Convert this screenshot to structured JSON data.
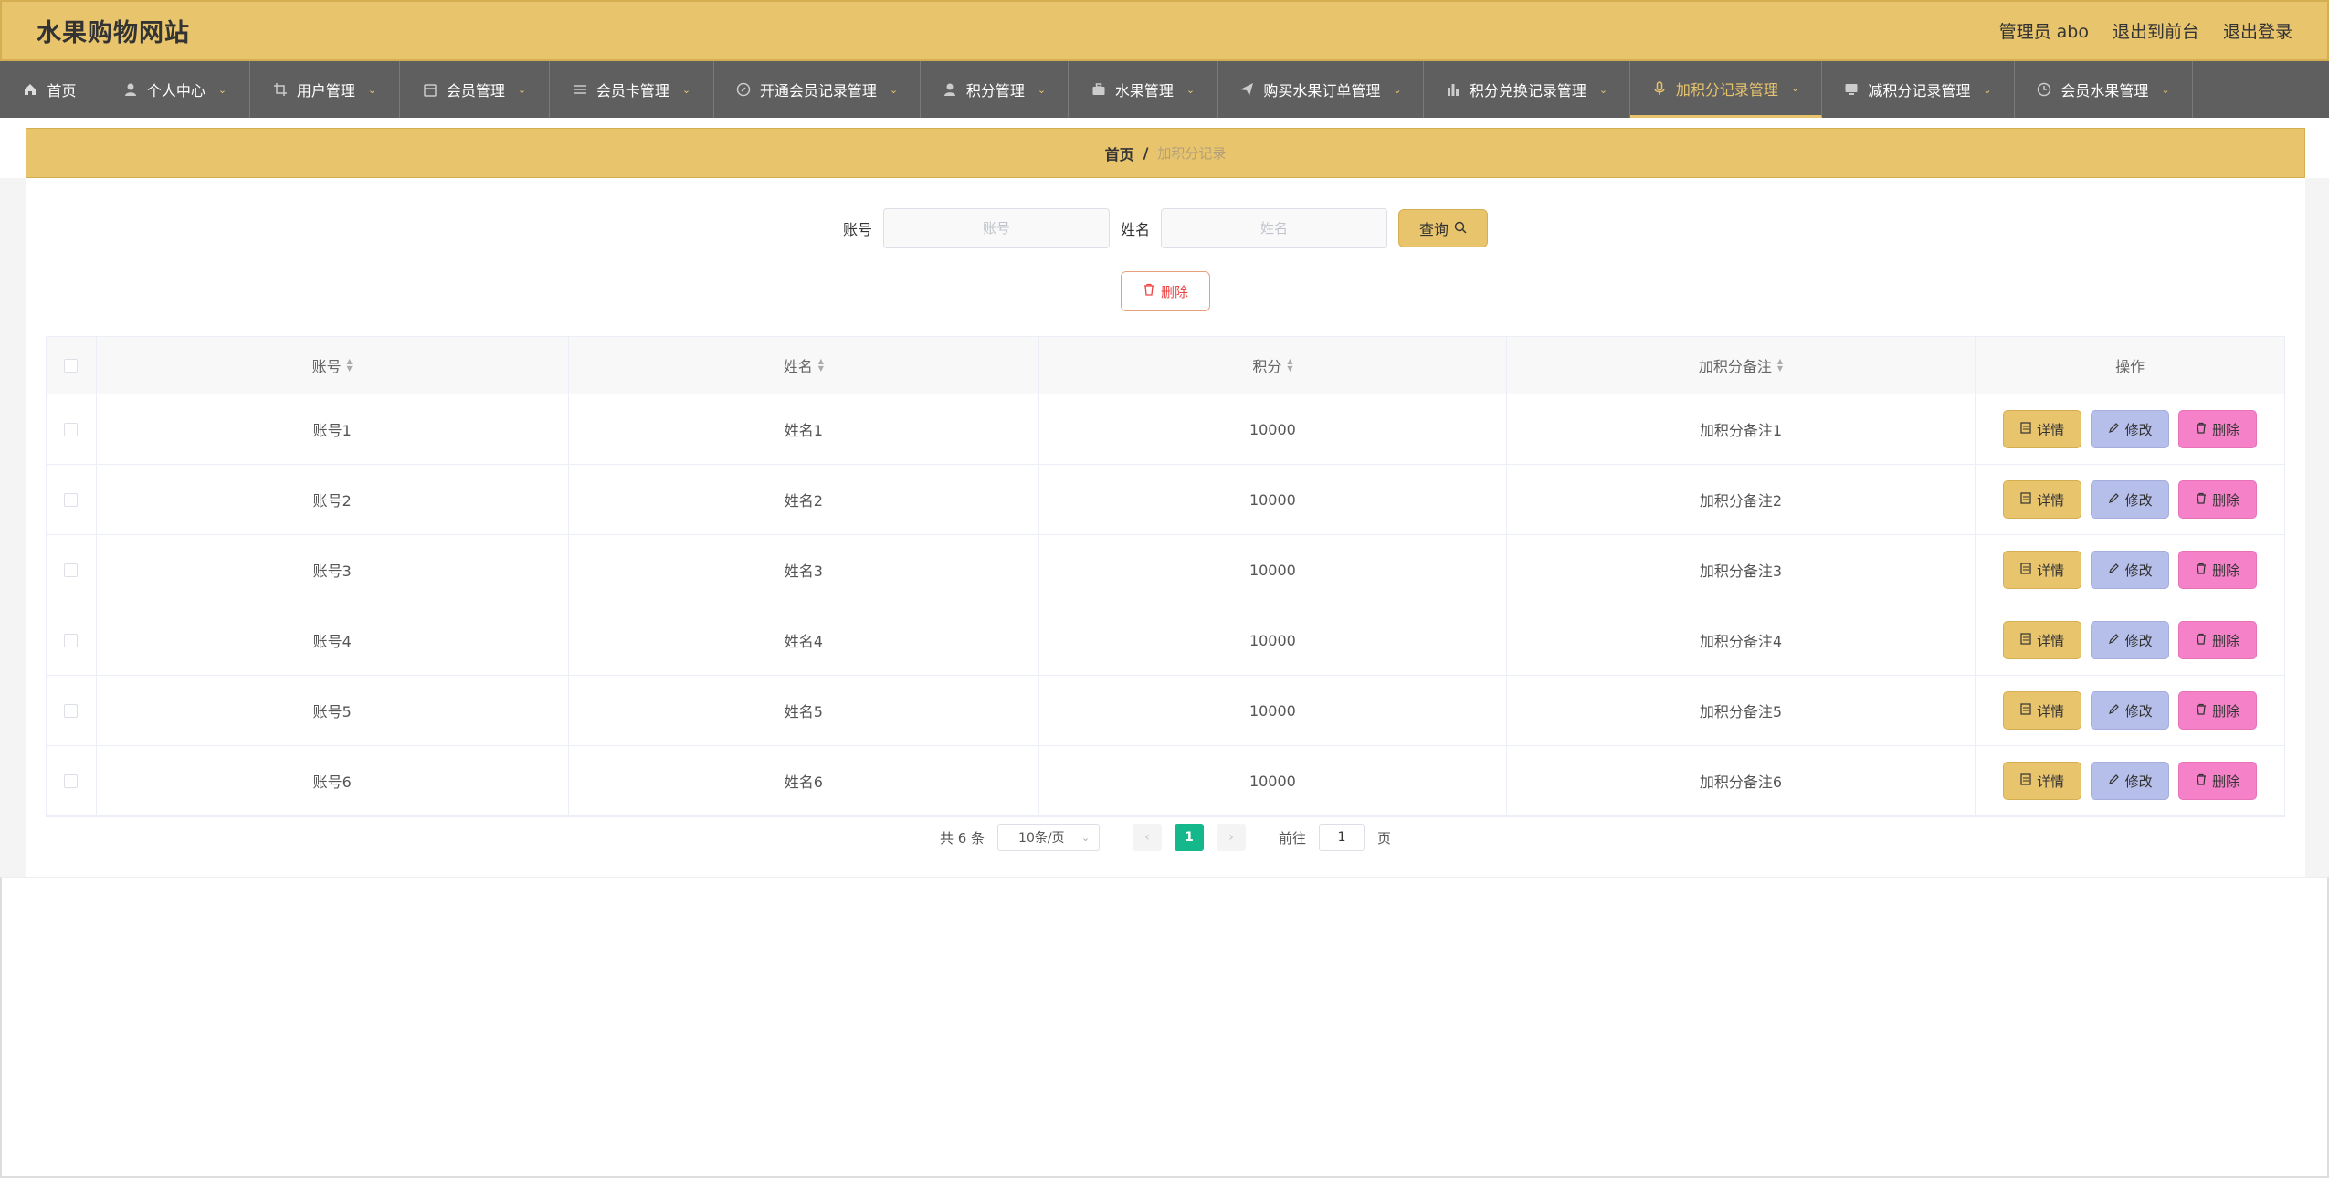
{
  "header": {
    "site_title": "水果购物网站",
    "admin_label": "管理员 abo",
    "exit_front_label": "退出到前台",
    "logout_label": "退出登录"
  },
  "nav": {
    "items": [
      {
        "label": "首页",
        "icon": "home-icon"
      },
      {
        "label": "个人中心",
        "icon": "user-icon"
      },
      {
        "label": "用户管理",
        "icon": "crop-icon"
      },
      {
        "label": "会员管理",
        "icon": "calendar-icon"
      },
      {
        "label": "会员卡管理",
        "icon": "sliders-icon"
      },
      {
        "label": "开通会员记录管理",
        "icon": "compass-icon"
      },
      {
        "label": "积分管理",
        "icon": "person-icon"
      },
      {
        "label": "水果管理",
        "icon": "briefcase-icon"
      },
      {
        "label": "购买水果订单管理",
        "icon": "send-icon"
      },
      {
        "label": "积分兑换记录管理",
        "icon": "chart-icon"
      },
      {
        "label": "加积分记录管理",
        "icon": "microphone-icon"
      },
      {
        "label": "减积分记录管理",
        "icon": "monitor-icon"
      },
      {
        "label": "会员水果管理",
        "icon": "clock-icon"
      }
    ],
    "active_index": 10
  },
  "breadcrumb": {
    "home": "首页",
    "separator": "/",
    "current": "加积分记录"
  },
  "search": {
    "account_label": "账号",
    "account_placeholder": "账号",
    "name_label": "姓名",
    "name_placeholder": "姓名",
    "query_label": "查询"
  },
  "toolbar": {
    "delete_label": "删除"
  },
  "table": {
    "columns": [
      "账号",
      "姓名",
      "积分",
      "加积分备注",
      "操作"
    ],
    "rows": [
      {
        "account": "账号1",
        "name": "姓名1",
        "points": "10000",
        "note": "加积分备注1"
      },
      {
        "account": "账号2",
        "name": "姓名2",
        "points": "10000",
        "note": "加积分备注2"
      },
      {
        "account": "账号3",
        "name": "姓名3",
        "points": "10000",
        "note": "加积分备注3"
      },
      {
        "account": "账号4",
        "name": "姓名4",
        "points": "10000",
        "note": "加积分备注4"
      },
      {
        "account": "账号5",
        "name": "姓名5",
        "points": "10000",
        "note": "加积分备注5"
      },
      {
        "account": "账号6",
        "name": "姓名6",
        "points": "10000",
        "note": "加积分备注6"
      }
    ],
    "actions": {
      "detail": "详情",
      "edit": "修改",
      "remove": "删除"
    }
  },
  "pagination": {
    "total_label": "共 6 条",
    "page_size_label": "10条/页",
    "current_page": "1",
    "goto_prefix": "前往",
    "goto_value": "1",
    "goto_suffix": "页"
  },
  "colors": {
    "accent": "#e8c46d",
    "nav_bg": "#5f5f5f",
    "edit": "#b6bfe9",
    "remove": "#f582c8",
    "page_active": "#14b88a"
  }
}
